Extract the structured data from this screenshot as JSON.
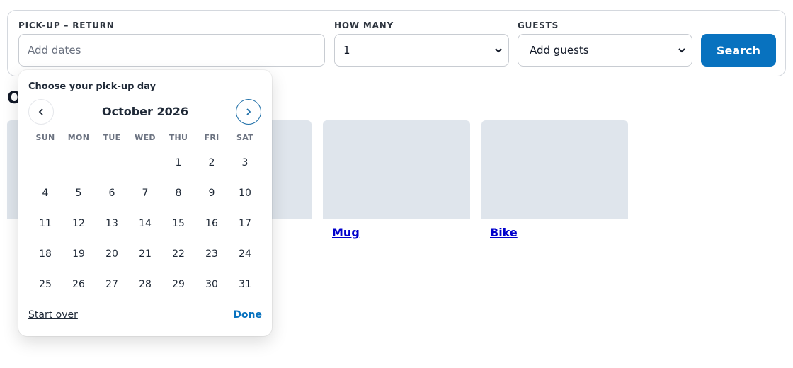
{
  "search": {
    "pickup_return_label": "PICK-UP – RETURN",
    "dates_placeholder": "Add dates",
    "how_many_label": "HOW MANY",
    "how_many_value": "1",
    "guests_label": "GUESTS",
    "guests_value": "Add guests",
    "search_button": "Search"
  },
  "page": {
    "heading_partial": "O",
    "cards": [
      {
        "label": "Mug"
      },
      {
        "label": "Bike"
      }
    ]
  },
  "calendar": {
    "title": "Choose your pick-up day",
    "month": "October 2026",
    "weekdays": [
      "SUN",
      "MON",
      "TUE",
      "WED",
      "THU",
      "FRI",
      "SAT"
    ],
    "weeks": [
      [
        "",
        "",
        "",
        "",
        "1",
        "2",
        "3"
      ],
      [
        "4",
        "5",
        "6",
        "7",
        "8",
        "9",
        "10"
      ],
      [
        "11",
        "12",
        "13",
        "14",
        "15",
        "16",
        "17"
      ],
      [
        "18",
        "19",
        "20",
        "21",
        "22",
        "23",
        "24"
      ],
      [
        "25",
        "26",
        "27",
        "28",
        "29",
        "30",
        "31"
      ]
    ],
    "start_over": "Start over",
    "done": "Done"
  },
  "colors": {
    "accent": "#0872bf",
    "card_placeholder": "#dfe5ec",
    "link": "#0000cc"
  }
}
